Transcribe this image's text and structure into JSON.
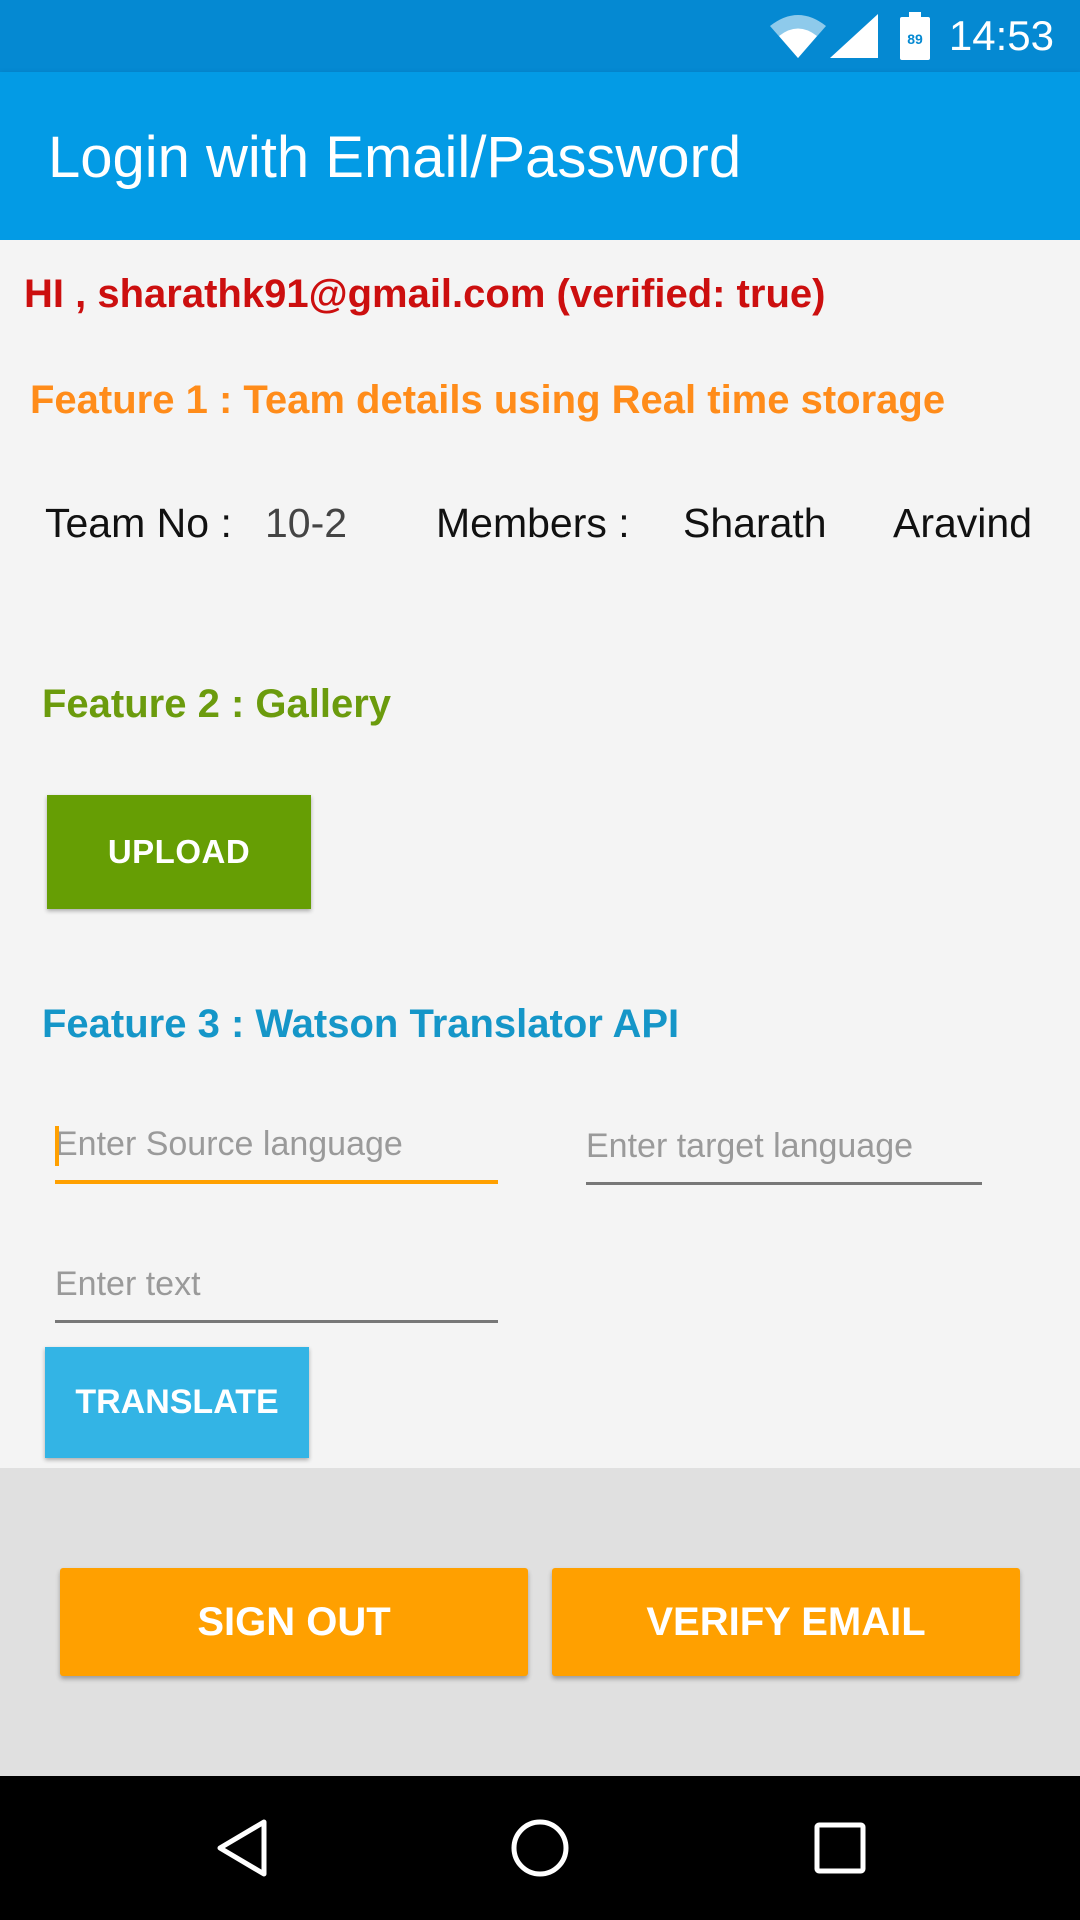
{
  "status_bar": {
    "time": "14:53",
    "battery_level": "89",
    "icons": [
      "wifi-icon",
      "signal-icon",
      "battery-icon"
    ]
  },
  "app_bar": {
    "title": "Login with Email/Password"
  },
  "greeting": "HI , sharathk91@gmail.com (verified: true)",
  "feature1": {
    "title": "Feature 1 : Team details using Real time storage",
    "team_label": "Team No :",
    "team_value": "10-2",
    "members_label": "Members :",
    "members": [
      "Sharath",
      "Aravind"
    ]
  },
  "feature2": {
    "title": "Feature 2 : Gallery",
    "upload_label": "UPLOAD"
  },
  "feature3": {
    "title": "Feature 3 : Watson Translator API",
    "source_placeholder": "Enter Source language",
    "target_placeholder": "Enter target language",
    "text_placeholder": "Enter text",
    "translate_label": "TRANSLATE"
  },
  "actions": {
    "sign_out_label": "SIGN OUT",
    "verify_email_label": "VERIFY EMAIL"
  },
  "navigation": {
    "buttons": [
      "back-icon",
      "home-icon",
      "recents-icon"
    ]
  },
  "colors": {
    "status_bar": "#0589d2",
    "app_bar": "#039be5",
    "greeting": "#cc0f0f",
    "feature1": "#ff8c1a",
    "feature2": "#6b9b0d",
    "feature3": "#1596c8",
    "upload_button": "#669e04",
    "translate_button": "#33b4e5",
    "bottom_buttons": "#ffa000"
  }
}
